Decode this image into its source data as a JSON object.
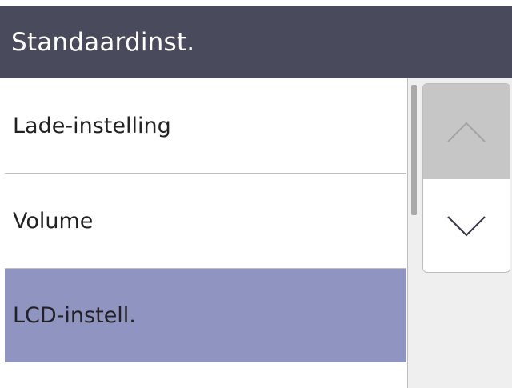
{
  "header": {
    "title": "Standaardinst."
  },
  "menu": {
    "items": [
      {
        "label": "Lade-instelling",
        "selected": false
      },
      {
        "label": "Volume",
        "selected": false
      },
      {
        "label": "LCD-instell.",
        "selected": true
      },
      {
        "label": "",
        "selected": false
      }
    ]
  },
  "scroll": {
    "up_icon": "chevron-up-icon",
    "down_icon": "chevron-down-icon",
    "up_state": "disabled",
    "down_state": "enabled"
  },
  "colors": {
    "header_bg": "#494a5b",
    "selected_bg": "#8f94c1",
    "disabled_button_bg": "#c6c6c6"
  }
}
